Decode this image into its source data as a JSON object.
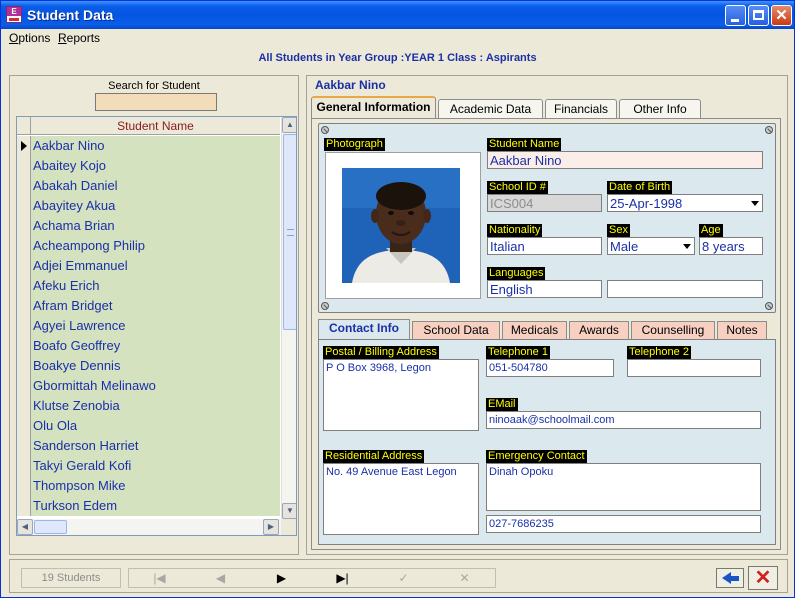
{
  "window": {
    "title": "Student Data",
    "app_icon_text": "E"
  },
  "menu": {
    "options": {
      "accel": "O",
      "rest": "ptions"
    },
    "reports": {
      "accel": "R",
      "rest": "eports"
    }
  },
  "heading": "All Students in Year Group :YEAR 1  Class : Aspirants",
  "search": {
    "label": "Search for Student",
    "value": ""
  },
  "grid": {
    "column_header": "Student Name",
    "selected_index": 0,
    "rows": [
      "Aakbar Nino",
      "Abaitey Kojo",
      "Abakah Daniel",
      "Abayitey Akua",
      "Achama Brian",
      "Acheampong Philip",
      "Adjei Emmanuel",
      "Afeku Erich",
      "Afram Bridget",
      "Agyei Lawrence",
      "Boafo Geoffrey",
      "Boakye Dennis",
      "Gbormittah Melinawo",
      "Klutse Zenobia",
      "Olu Ola",
      "Sanderson Harriet",
      "Takyi Gerald Kofi",
      "Thompson Mike",
      "Turkson Edem"
    ]
  },
  "student": {
    "header_name": "Aakbar  Nino",
    "photograph_label": "Photograph",
    "name_label": "Student Name",
    "name_value": "Aakbar Nino",
    "school_id_label": "School ID #",
    "school_id_value": "ICS004",
    "dob_label": "Date of Birth",
    "dob_value": "25-Apr-1998",
    "nationality_label": "Nationality",
    "nationality_value": "Italian",
    "sex_label": "Sex",
    "sex_value": "Male",
    "age_label": "Age",
    "age_value": "8 years",
    "languages_label": "Languages",
    "language_1": "English",
    "language_2": ""
  },
  "main_tabs": [
    {
      "label": "General Information"
    },
    {
      "label": "Academic Data"
    },
    {
      "label": "Financials"
    },
    {
      "label": "Other Info"
    }
  ],
  "sub_tabs": [
    {
      "label": "Contact Info"
    },
    {
      "label": "School Data"
    },
    {
      "label": "Medicals"
    },
    {
      "label": "Awards"
    },
    {
      "label": "Counselling"
    },
    {
      "label": "Notes"
    }
  ],
  "contact": {
    "postal_label": "Postal / Billing Address",
    "postal_value": "P O Box 3968, Legon",
    "tel1_label": "Telephone 1",
    "tel1_value": "051-504780",
    "tel2_label": "Telephone 2",
    "tel2_value": "",
    "email_label": "EMail",
    "email_value": "ninoaak@schoolmail.com",
    "residential_label": "Residential Address",
    "residential_value": "No. 49 Avenue East Legon",
    "emergency_label": "Emergency Contact",
    "emergency_value": "Dinah Opoku",
    "emergency_phone": "027-7686235"
  },
  "status": {
    "count": "19 Students",
    "nav_first": "|◀",
    "nav_prev": "◀",
    "nav_next": "▶",
    "nav_last": "▶|",
    "nav_save": "✓",
    "nav_undo": "✕",
    "cancel_glyph": "✕"
  },
  "colors": {
    "title_bar": "#0554e3",
    "heading_text": "#1b2fa6",
    "grid_row": "#d5e2c0",
    "field_label_bg": "#000000",
    "field_label_text": "#ffff00",
    "subtab": "#f7d0c2"
  }
}
